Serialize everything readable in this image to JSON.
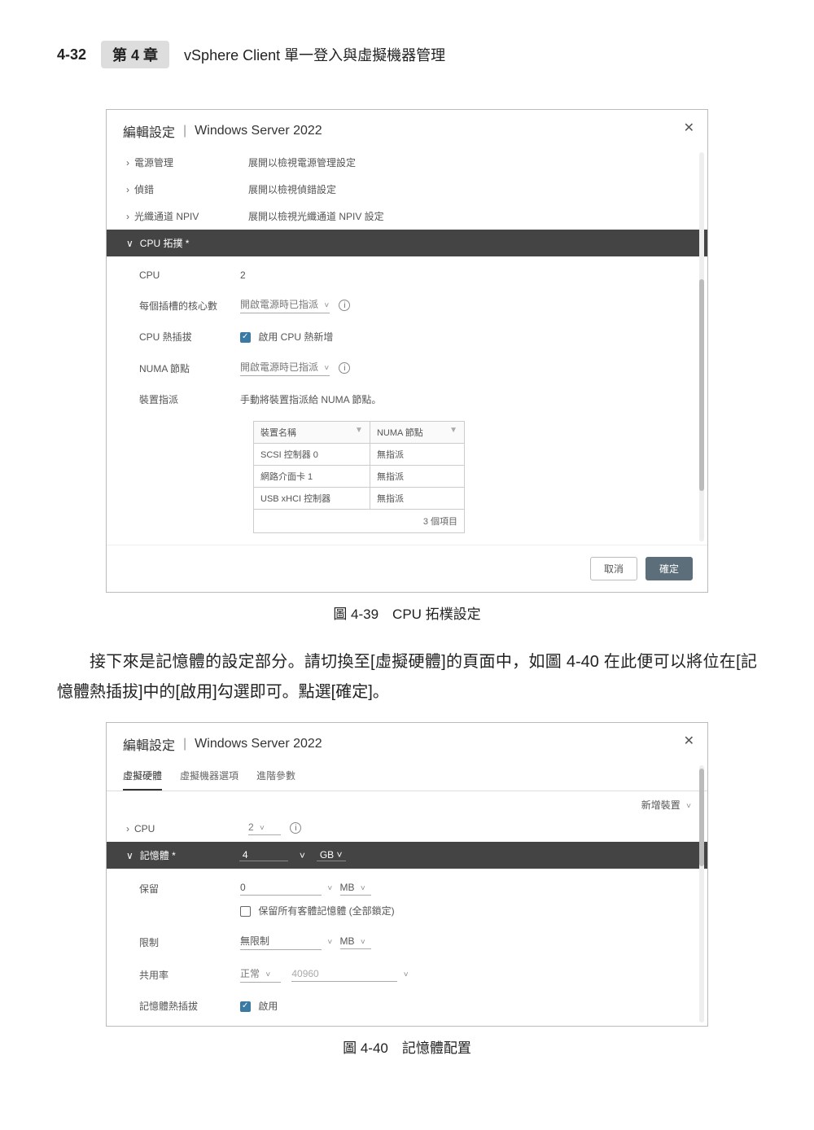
{
  "header": {
    "page_num": "4-32",
    "chapter_tab": "第 4 章",
    "chapter_title": "vSphere Client 單一登入與虛擬機器管理"
  },
  "dialog1": {
    "title_prefix": "編輯設定",
    "title_subject": "Windows Server 2022",
    "rows": {
      "power": {
        "label": "電源管理",
        "value": "展開以檢視電源管理設定"
      },
      "debug": {
        "label": "偵錯",
        "value": "展開以檢視偵錯設定"
      },
      "npiv": {
        "label": "光纖通道 NPIV",
        "value": "展開以檢視光纖通道 NPIV 設定"
      }
    },
    "cpu_topology_bar": "CPU 拓撲 *",
    "inner": {
      "cpu": {
        "label": "CPU",
        "value": "2"
      },
      "cores": {
        "label": "每個插槽的核心數",
        "value": "開啟電源時已指派"
      },
      "hotplug": {
        "label": "CPU 熱插拔",
        "checkbox_label": "啟用 CPU 熱新增"
      },
      "numa": {
        "label": "NUMA 節點",
        "value": "開啟電源時已指派"
      },
      "assign": {
        "label": "裝置指派",
        "desc": "手動將裝置指派給 NUMA 節點。"
      }
    },
    "device_table": {
      "col1": "裝置名稱",
      "col2": "NUMA 節點",
      "rows": [
        {
          "name": "SCSI 控制器 0",
          "node": "無指派"
        },
        {
          "name": "網路介面卡 1",
          "node": "無指派"
        },
        {
          "name": "USB xHCI 控制器",
          "node": "無指派"
        }
      ],
      "footer": "3 個項目"
    },
    "buttons": {
      "cancel": "取消",
      "ok": "確定"
    }
  },
  "caption1": "圖 4-39　CPU 拓樸設定",
  "paragraph": "接下來是記憶體的設定部分。請切換至[虛擬硬體]的頁面中，如圖 4-40 在此便可以將位在[記憶體熱插拔]中的[啟用]勾選即可。點選[確定]。",
  "dialog2": {
    "title_prefix": "編輯設定",
    "title_subject": "Windows Server 2022",
    "tabs": {
      "t1": "虛擬硬體",
      "t2": "虛擬機器選項",
      "t3": "進階參數"
    },
    "add_device": "新增裝置",
    "cpu_row": {
      "label": "CPU",
      "value": "2"
    },
    "memory_bar": {
      "label": "記憶體 *",
      "value": "4",
      "unit": "GB"
    },
    "inner": {
      "reserve": {
        "label": "保留",
        "value": "0",
        "unit": "MB",
        "sub_checkbox": "保留所有客體記憶體 (全部鎖定)"
      },
      "limit": {
        "label": "限制",
        "value": "無限制",
        "unit": "MB"
      },
      "shares": {
        "label": "共用率",
        "level": "正常",
        "value": "40960"
      },
      "hotplug": {
        "label": "記憶體熱插拔",
        "checkbox_label": "啟用"
      }
    }
  },
  "caption2": "圖 4-40　記憶體配置"
}
